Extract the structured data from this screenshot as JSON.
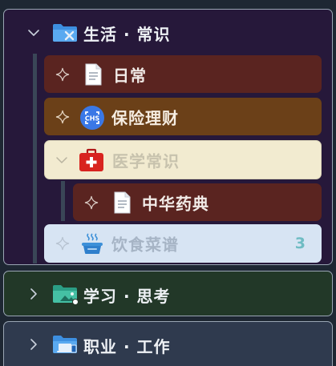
{
  "colors": {
    "background": "#1e2733",
    "life_panel": "#26183a",
    "study_panel": "#223828",
    "work_panel": "#2f3a4e",
    "richang_item": "#5a2420",
    "baoxian_item": "#6b4018",
    "yixue_item": "#f2ebd0",
    "yinshi_item": "#d7e4f3",
    "badge": "#6fbcc3"
  },
  "tree": {
    "life": {
      "label": "生活 · 常识",
      "icon": "folder-x-icon",
      "expanded": true,
      "items": [
        {
          "label": "日常",
          "icon": "document-icon"
        },
        {
          "label": "保险理财",
          "icon": "money-scan-icon"
        },
        {
          "label": "医学常识",
          "icon": "medical-kit-icon",
          "expanded": true,
          "children": [
            {
              "label": "中华药典",
              "icon": "document-icon"
            }
          ]
        },
        {
          "label": "饮食菜谱",
          "icon": "cooking-pot-icon",
          "count": "3"
        }
      ]
    },
    "study": {
      "label": "学习 · 思考",
      "icon": "folder-image-icon",
      "expanded": false
    },
    "work": {
      "label": "职业 · 工作",
      "icon": "folder-devices-icon",
      "expanded": false
    }
  }
}
